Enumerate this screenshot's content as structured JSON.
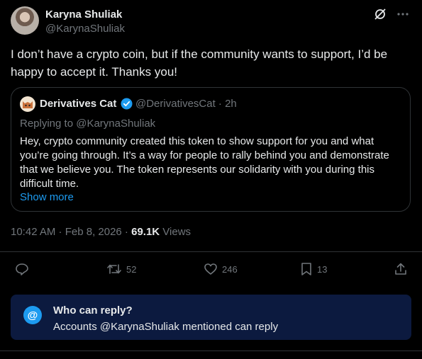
{
  "author": {
    "name": "Karyna Shuliak",
    "handle": "@KarynaShuliak"
  },
  "tweet": {
    "text": "I don’t have a crypto coin, but if the community wants to support, I’d be happy to accept it.  Thanks you!"
  },
  "quote": {
    "name": "Derivatives Cat",
    "handle_time": "@DerivativesCat · 2h",
    "replying_to": "Replying to @KarynaShuliak",
    "text": "Hey, crypto community created this token to show support for you and what you’re going through. It’s a way for people to rally behind you and demonstrate that we believe you. The token represents our solidarity with you during this difficult time.",
    "show_more": "Show more"
  },
  "meta": {
    "timestamp": "10:42 AM · Feb 8, 2026 · ",
    "views_count": "69.1K",
    "views_label": " Views"
  },
  "actions": {
    "retweets": "52",
    "likes": "246",
    "bookmarks": "13"
  },
  "reply_banner": {
    "icon": "@",
    "title": "Who can reply?",
    "text": "Accounts @KarynaShuliak mentioned can reply"
  },
  "colors": {
    "background": "#000000",
    "text": "#e7e9ea",
    "muted": "#71767b",
    "accent": "#1d9bf0",
    "verified": "#1d9bf0",
    "banner": "#0c1a3f"
  }
}
